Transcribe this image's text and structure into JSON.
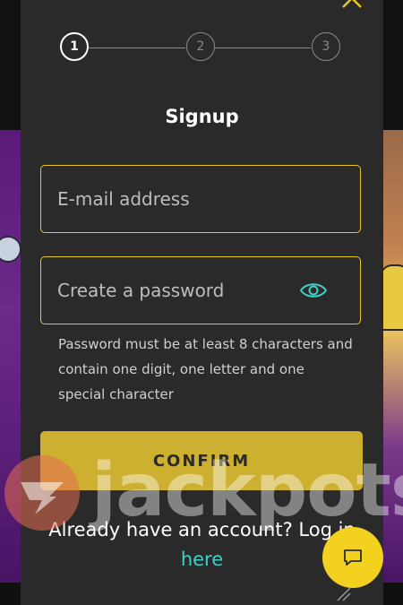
{
  "stepper": {
    "steps": [
      "1",
      "2",
      "3"
    ],
    "active_step": 1
  },
  "form": {
    "title": "Signup",
    "email_placeholder": "E-mail address",
    "password_placeholder": "Create a password",
    "password_hint": "Password must be at least 8 characters and contain one digit, one letter and one special character",
    "confirm_label": "CONFIRM",
    "login_prompt": "Already have an account? Log in ",
    "login_link": "here"
  },
  "watermark": {
    "text": "jackpots"
  },
  "colors": {
    "panel": "#2a2a2a",
    "accent_yellow": "#e7c725",
    "link_teal": "#3fd0c8",
    "chat_button": "#f2d21e"
  },
  "icons": {
    "close": "chevron-up-icon",
    "password_toggle": "eye-icon",
    "chat": "chat-bubble-icon",
    "resize": "resize-grip-icon"
  }
}
